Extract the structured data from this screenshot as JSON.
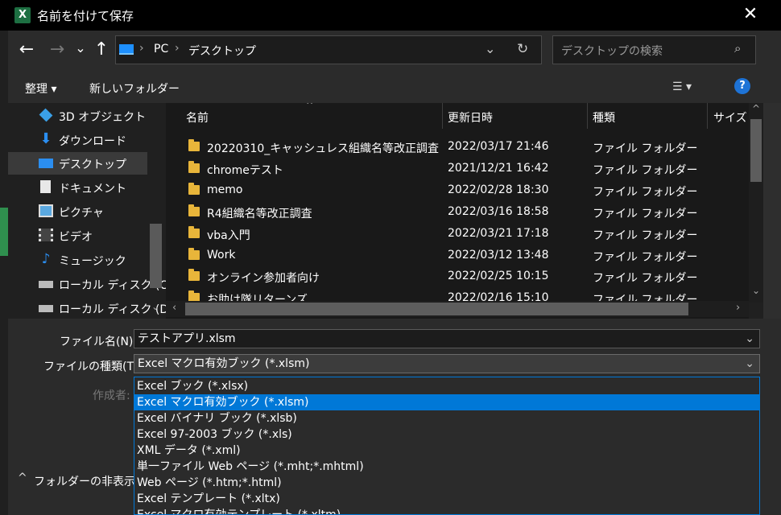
{
  "window": {
    "title": "名前を付けて保存",
    "app_icon": "X",
    "close": "✕"
  },
  "nav": {
    "back": "←",
    "forward": "→",
    "recent": "⌄",
    "up": "↑",
    "breadcrumb": [
      "PC",
      "デスクトップ"
    ],
    "search_placeholder": "デスクトップの検索"
  },
  "toolbar": {
    "organize": "整理 ▾",
    "new_folder": "新しいフォルダー",
    "view": "☰ ▾",
    "help": "?"
  },
  "sidebar": {
    "items": [
      {
        "label": "3D オブジェクト",
        "icon": "cube-3d-icon"
      },
      {
        "label": "ダウンロード",
        "icon": "download-icon"
      },
      {
        "label": "デスクトップ",
        "icon": "desktop-icon"
      },
      {
        "label": "ドキュメント",
        "icon": "document-icon"
      },
      {
        "label": "ピクチャ",
        "icon": "picture-icon"
      },
      {
        "label": "ビデオ",
        "icon": "video-icon"
      },
      {
        "label": "ミュージック",
        "icon": "music-icon"
      },
      {
        "label": "ローカル ディスク (C",
        "icon": "drive-icon"
      },
      {
        "label": "ローカル ディスク (D",
        "icon": "drive-icon"
      }
    ]
  },
  "filelist": {
    "columns": {
      "name": "名前",
      "date": "更新日時",
      "type": "種類",
      "size": "サイズ"
    },
    "rows": [
      {
        "name": "20220310_キャッシュレス組織名等改正調査",
        "date": "2022/03/17 21:46",
        "type": "ファイル フォルダー"
      },
      {
        "name": "chromeテスト",
        "date": "2021/12/21 16:42",
        "type": "ファイル フォルダー"
      },
      {
        "name": "memo",
        "date": "2022/02/28 18:30",
        "type": "ファイル フォルダー"
      },
      {
        "name": "R4組織名等改正調査",
        "date": "2022/03/16 18:58",
        "type": "ファイル フォルダー"
      },
      {
        "name": "vba入門",
        "date": "2022/03/21 17:18",
        "type": "ファイル フォルダー"
      },
      {
        "name": "Work",
        "date": "2022/03/12 13:48",
        "type": "ファイル フォルダー"
      },
      {
        "name": "オンライン参加者向け",
        "date": "2022/02/25 10:15",
        "type": "ファイル フォルダー"
      },
      {
        "name": "お助け隊リターンズ",
        "date": "2022/02/16 15:10",
        "type": "ファイル フォルダー"
      }
    ]
  },
  "form": {
    "filename_label": "ファイル名(N):",
    "filename_value": "テストアプリ.xlsm",
    "filetype_label": "ファイルの種類(T):",
    "filetype_value": "Excel マクロ有効ブック (*.xlsm)",
    "author_label": "作成者:",
    "hide_folders": "フォルダーの非表示"
  },
  "dropdown": {
    "selected_index": 1,
    "options": [
      "Excel ブック (*.xlsx)",
      "Excel マクロ有効ブック (*.xlsm)",
      "Excel バイナリ ブック (*.xlsb)",
      "Excel 97-2003 ブック (*.xls)",
      "XML データ (*.xml)",
      "単一ファイル Web ページ (*.mht;*.mhtml)",
      "Web ページ (*.htm;*.html)",
      "Excel テンプレート (*.xltx)",
      "Excel マクロ有効テンプレート (*.xltm)"
    ]
  },
  "colors": {
    "accent": "#0078d7",
    "folder": "#e8b53a",
    "excel": "#1d6f42"
  }
}
